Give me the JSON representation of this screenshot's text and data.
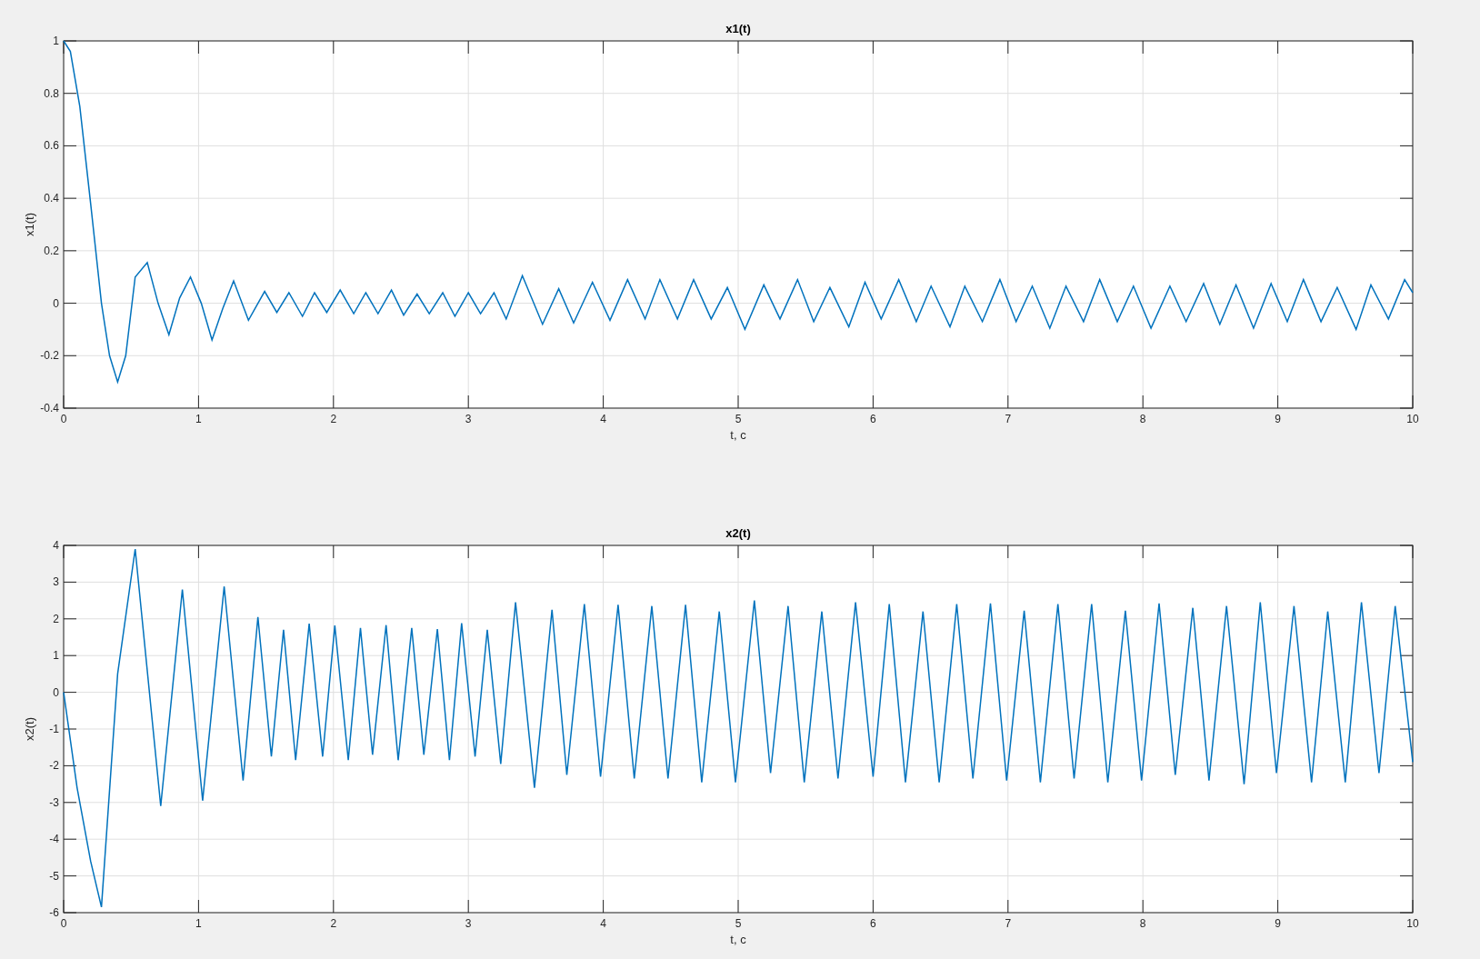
{
  "figure": {
    "charts": [
      {
        "chart_data": {
          "type": "line",
          "title": "x1(t)",
          "xlabel": "t, c",
          "ylabel": "x1(t)",
          "xlim": [
            0,
            10
          ],
          "ylim": [
            -0.4,
            1
          ],
          "xticks": [
            0,
            1,
            2,
            3,
            4,
            5,
            6,
            7,
            8,
            9,
            10
          ],
          "yticks": [
            -0.4,
            -0.2,
            0,
            0.2,
            0.4,
            0.6,
            0.8,
            1
          ],
          "x": [
            0,
            0.05,
            0.12,
            0.2,
            0.28,
            0.34,
            0.4,
            0.46,
            0.53,
            0.62,
            0.7,
            0.78,
            0.86,
            0.94,
            1.02,
            1.1,
            1.18,
            1.26,
            1.37,
            1.49,
            1.58,
            1.67,
            1.77,
            1.86,
            1.95,
            2.05,
            2.15,
            2.24,
            2.33,
            2.43,
            2.52,
            2.62,
            2.71,
            2.81,
            2.9,
            3.0,
            3.09,
            3.19,
            3.28,
            3.4,
            3.55,
            3.67,
            3.78,
            3.92,
            4.05,
            4.18,
            4.31,
            4.42,
            4.55,
            4.67,
            4.8,
            4.92,
            5.05,
            5.19,
            5.31,
            5.44,
            5.56,
            5.68,
            5.82,
            5.94,
            6.06,
            6.19,
            6.32,
            6.43,
            6.57,
            6.68,
            6.81,
            6.94,
            7.06,
            7.18,
            7.31,
            7.43,
            7.56,
            7.68,
            7.81,
            7.93,
            8.06,
            8.2,
            8.32,
            8.45,
            8.57,
            8.69,
            8.82,
            8.95,
            9.07,
            9.19,
            9.32,
            9.44,
            9.58,
            9.69,
            9.82,
            9.94,
            10
          ],
          "grid": true,
          "series": [
            {
              "color": "#0072bd",
              "values": [
                1,
                0.96,
                0.75,
                0.38,
                0.0,
                -0.2,
                -0.3,
                -0.2,
                0.1,
                0.155,
                0.0,
                -0.12,
                0.02,
                0.1,
                0.0,
                -0.14,
                -0.02,
                0.085,
                -0.065,
                0.045,
                -0.035,
                0.04,
                -0.05,
                0.04,
                -0.035,
                0.05,
                -0.04,
                0.04,
                -0.04,
                0.05,
                -0.045,
                0.035,
                -0.04,
                0.04,
                -0.05,
                0.04,
                -0.04,
                0.04,
                -0.06,
                0.105,
                -0.08,
                0.055,
                -0.075,
                0.08,
                -0.065,
                0.09,
                -0.06,
                0.09,
                -0.06,
                0.09,
                -0.06,
                0.06,
                -0.1,
                0.07,
                -0.06,
                0.09,
                -0.07,
                0.06,
                -0.09,
                0.08,
                -0.06,
                0.09,
                -0.07,
                0.065,
                -0.09,
                0.065,
                -0.07,
                0.09,
                -0.07,
                0.065,
                -0.095,
                0.065,
                -0.07,
                0.09,
                -0.07,
                0.065,
                -0.095,
                0.065,
                -0.07,
                0.075,
                -0.08,
                0.07,
                -0.095,
                0.075,
                -0.07,
                0.09,
                -0.07,
                0.06,
                -0.1,
                0.07,
                -0.06,
                0.09,
                0.04
              ]
            }
          ]
        }
      },
      {
        "chart_data": {
          "type": "line",
          "title": "x2(t)",
          "xlabel": "t, c",
          "ylabel": "x2(t)",
          "xlim": [
            0,
            10
          ],
          "ylim": [
            -6,
            4
          ],
          "xticks": [
            0,
            1,
            2,
            3,
            4,
            5,
            6,
            7,
            8,
            9,
            10
          ],
          "yticks": [
            -6,
            -5,
            -4,
            -3,
            -2,
            -1,
            0,
            1,
            2,
            3,
            4
          ],
          "x": [
            0,
            0.1,
            0.2,
            0.28,
            0.4,
            0.53,
            0.72,
            0.88,
            1.03,
            1.19,
            1.33,
            1.44,
            1.54,
            1.63,
            1.72,
            1.82,
            1.92,
            2.01,
            2.11,
            2.2,
            2.29,
            2.39,
            2.48,
            2.58,
            2.67,
            2.77,
            2.86,
            2.95,
            3.05,
            3.14,
            3.24,
            3.35,
            3.49,
            3.62,
            3.73,
            3.86,
            3.98,
            4.11,
            4.23,
            4.36,
            4.48,
            4.61,
            4.73,
            4.86,
            4.98,
            5.12,
            5.24,
            5.37,
            5.49,
            5.62,
            5.74,
            5.87,
            6.0,
            6.12,
            6.24,
            6.37,
            6.49,
            6.62,
            6.74,
            6.87,
            6.99,
            7.12,
            7.24,
            7.37,
            7.49,
            7.62,
            7.74,
            7.87,
            7.99,
            8.12,
            8.24,
            8.37,
            8.49,
            8.62,
            8.75,
            8.87,
            8.99,
            9.12,
            9.25,
            9.37,
            9.5,
            9.62,
            9.75,
            9.87,
            10
          ],
          "grid": true,
          "series": [
            {
              "color": "#0072bd",
              "values": [
                0,
                -2.6,
                -4.6,
                -5.85,
                0.5,
                3.9,
                -3.1,
                2.8,
                -2.95,
                2.88,
                -2.4,
                2.05,
                -1.75,
                1.7,
                -1.85,
                1.87,
                -1.75,
                1.82,
                -1.85,
                1.75,
                -1.7,
                1.83,
                -1.85,
                1.75,
                -1.7,
                1.72,
                -1.85,
                1.88,
                -1.75,
                1.7,
                -1.95,
                2.45,
                -2.6,
                2.25,
                -2.25,
                2.4,
                -2.3,
                2.38,
                -2.35,
                2.35,
                -2.35,
                2.38,
                -2.45,
                2.2,
                -2.45,
                2.5,
                -2.2,
                2.35,
                -2.45,
                2.2,
                -2.35,
                2.45,
                -2.3,
                2.4,
                -2.45,
                2.2,
                -2.45,
                2.4,
                -2.35,
                2.42,
                -2.4,
                2.22,
                -2.45,
                2.4,
                -2.35,
                2.4,
                -2.45,
                2.22,
                -2.4,
                2.42,
                -2.25,
                2.3,
                -2.4,
                2.35,
                -2.5,
                2.45,
                -2.2,
                2.35,
                -2.45,
                2.2,
                -2.45,
                2.45,
                -2.2,
                2.35,
                -1.9
              ]
            }
          ]
        }
      }
    ]
  }
}
